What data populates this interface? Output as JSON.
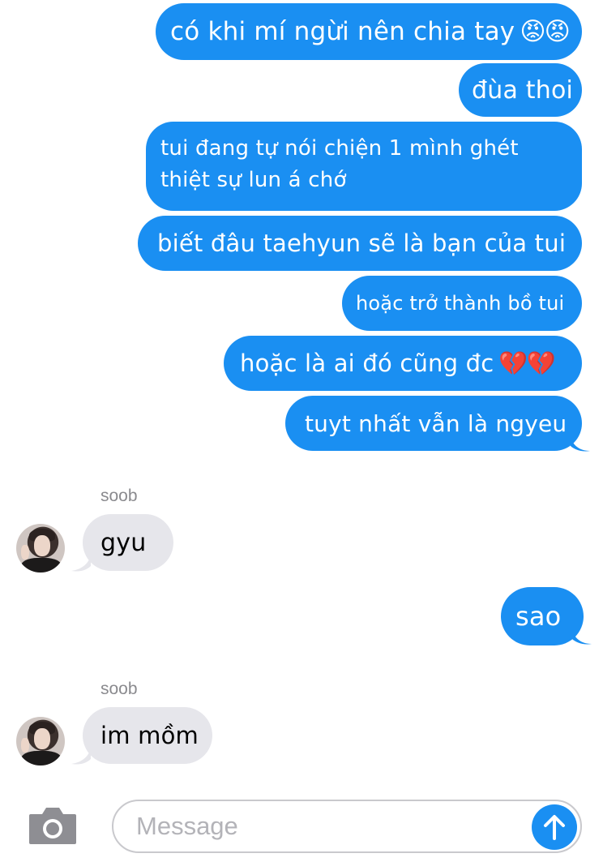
{
  "conversation": {
    "messages": [
      {
        "side": "out",
        "text": "có khi mí ngừi nên chia tay",
        "emoji": "😡😡"
      },
      {
        "side": "out",
        "text": "đùa thoi",
        "emoji": ""
      },
      {
        "side": "out",
        "text": "tui đang tự nói chiện 1 mình ghét thiệt sự lun á chớ",
        "emoji": ""
      },
      {
        "side": "out",
        "text": "biết đâu taehyun sẽ là bạn của tui",
        "emoji": ""
      },
      {
        "side": "out",
        "text": "hoặc trở thành bồ tui",
        "emoji": ""
      },
      {
        "side": "out",
        "text": "hoặc là ai đó cũng đc",
        "emoji": "💔💔"
      },
      {
        "side": "out",
        "text": "tuyt nhất vẫn là ngyeu",
        "emoji": ""
      },
      {
        "side": "in",
        "sender": "soob",
        "text": "gyu"
      },
      {
        "side": "out",
        "text": "sao",
        "emoji": ""
      },
      {
        "side": "in",
        "sender": "soob",
        "text": "im mồm"
      }
    ]
  },
  "composer": {
    "placeholder": "Message",
    "camera_icon": "camera-icon",
    "send_icon": "arrow-up-icon"
  },
  "colors": {
    "outgoing_bubble": "#1a8ff2",
    "incoming_bubble": "#e6e6eb",
    "sender_name": "#8a8a8e"
  }
}
